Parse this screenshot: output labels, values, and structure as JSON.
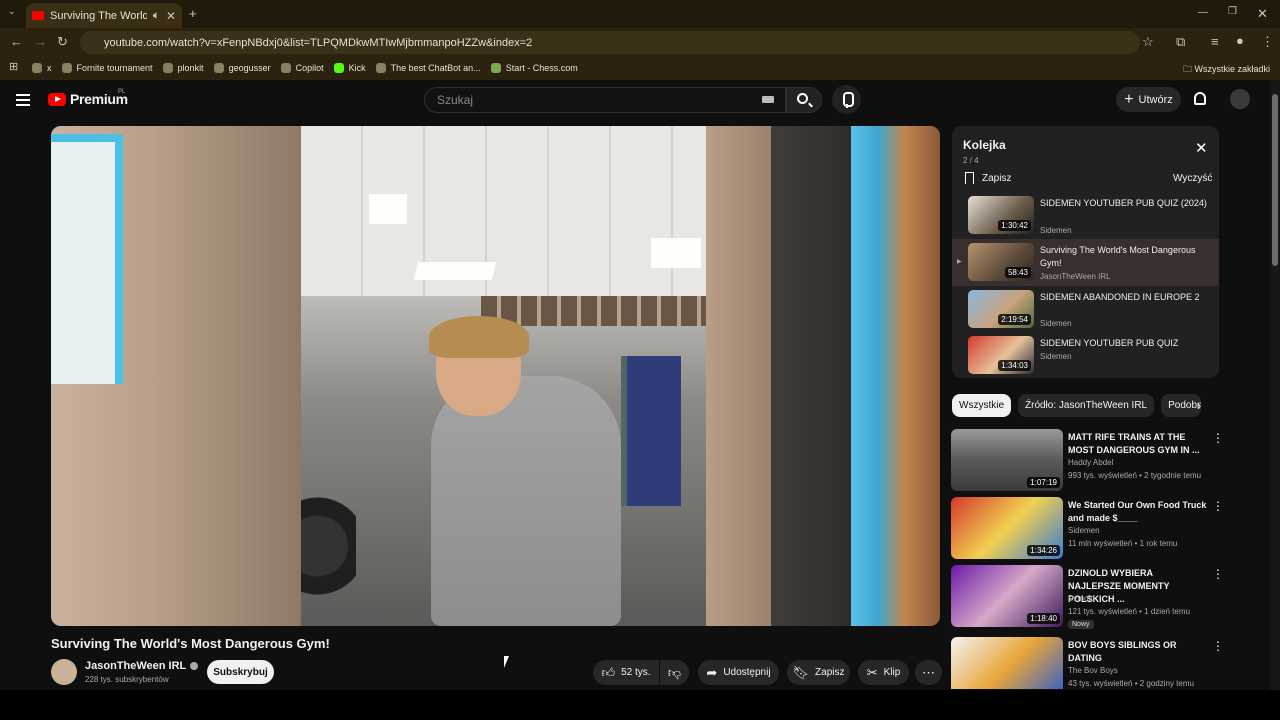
{
  "browser": {
    "tab_title": "Surviving The World's Most",
    "url": "youtube.com/watch?v=xFenpNBdxj0&list=TLPQMDkwMTIwMjbmmanpoHZZw&index=2",
    "bookmarks": [
      {
        "label": "x"
      },
      {
        "label": "Fornite tournament"
      },
      {
        "label": "plonkit"
      },
      {
        "label": "geogusser"
      },
      {
        "label": "Copilot"
      },
      {
        "label": "Kick"
      },
      {
        "label": "The best ChatBot an..."
      },
      {
        "label": "Start - Chess.com"
      }
    ],
    "all_bookmarks": "Wszystkie zakładki"
  },
  "header": {
    "logo_text": "Premium",
    "logo_sup": "PL",
    "search_placeholder": "Szukaj",
    "create_label": "Utwórz"
  },
  "video": {
    "title": "Surviving The World's Most Dangerous Gym!",
    "channel": "JasonTheWeen IRL",
    "subscribers": "228 tys. subskrybentów",
    "subscribe_label": "Subskrybuj",
    "likes": "52 tys.",
    "share_label": "Udostępnij",
    "save_label": "Zapisz",
    "clip_label": "Klip"
  },
  "queue": {
    "title": "Kolejka",
    "count": "2 / 4",
    "save_label": "Zapisz",
    "clear_label": "Wyczyść",
    "items": [
      {
        "title": "SIDEMEN YOUTUBER PUB QUIZ (2024)",
        "channel": "Sidemen",
        "duration": "1:30:42"
      },
      {
        "title": "Surviving The World's Most Dangerous Gym!",
        "channel": "JasonTheWeen IRL",
        "duration": "58:43"
      },
      {
        "title": "SIDEMEN ABANDONED IN EUROPE 2",
        "channel": "Sidemen",
        "duration": "2:19:54"
      },
      {
        "title": "SIDEMEN YOUTUBER PUB QUIZ",
        "channel": "Sidemen",
        "duration": "1:34:03"
      }
    ]
  },
  "chips": [
    "Wszystkie",
    "Źródło: JasonTheWeen IRL",
    "Podobne"
  ],
  "recommendations": [
    {
      "title": "MATT RIFE TRAINS AT THE MOST DANGEROUS GYM IN ...",
      "channel": "Haddy Abdel",
      "meta": "993 tys. wyświetleń • 2 tygodnie temu",
      "duration": "1:07:19"
    },
    {
      "title": "We Started Our Own Food Truck and made $____",
      "channel": "Sidemen",
      "meta": "11 mln wyświetleń • 1 rok temu",
      "duration": "1:34:26"
    },
    {
      "title": "DZINOLD WYBIERA NAJLEPSZE MOMENTY POLSKICH ...",
      "channel": "Dzinold",
      "meta": "121 tys. wyświetleń • 1 dzień temu",
      "duration": "1:18:40",
      "badge": "Nowy"
    },
    {
      "title": "BOV BOYS SIBLINGS OR DATING",
      "channel": "The Bov Boys",
      "meta": "43 tys. wyświetleń • 2 godziny temu"
    }
  ]
}
